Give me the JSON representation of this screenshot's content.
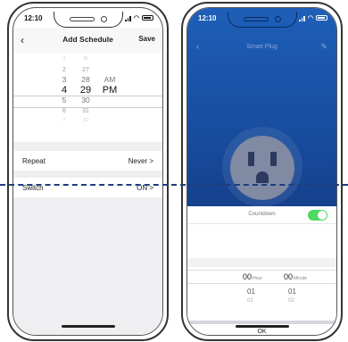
{
  "left_phone": {
    "status_time": "12:10",
    "nav": {
      "back_icon": "chevron-left-icon",
      "title": "Add Schedule",
      "save_label": "Save"
    },
    "picker": {
      "hours": [
        "1",
        "2",
        "3",
        "4",
        "5",
        "6",
        "7"
      ],
      "minutes": [
        "26",
        "27",
        "28",
        "29",
        "30",
        "31",
        "32"
      ],
      "ampm": [
        "AM",
        "PM"
      ],
      "selected": {
        "hour": "4",
        "minute": "29",
        "ampm": "PM"
      }
    },
    "repeat": {
      "label": "Repeat",
      "value": "Never >"
    },
    "switch": {
      "label": "Switch",
      "value": "ON >"
    }
  },
  "right_phone": {
    "status_time": "12:10",
    "title": "Smart Plug",
    "back_icon": "chevron-left-icon",
    "edit_icon": "pencil-icon",
    "countdown": {
      "label": "Countdown",
      "toggle_on": true
    },
    "timer": {
      "hour_value": "00",
      "hour_unit": "Hour",
      "minute_value": "00",
      "minute_unit": "Minute",
      "next_hour": [
        "01",
        "02"
      ],
      "next_minute": [
        "01",
        "02"
      ]
    },
    "ok_label": "OK"
  },
  "colors": {
    "accent_blue": "#1e5fb8",
    "toggle_green": "#4cd964",
    "dash_line": "#1d3e7e"
  }
}
